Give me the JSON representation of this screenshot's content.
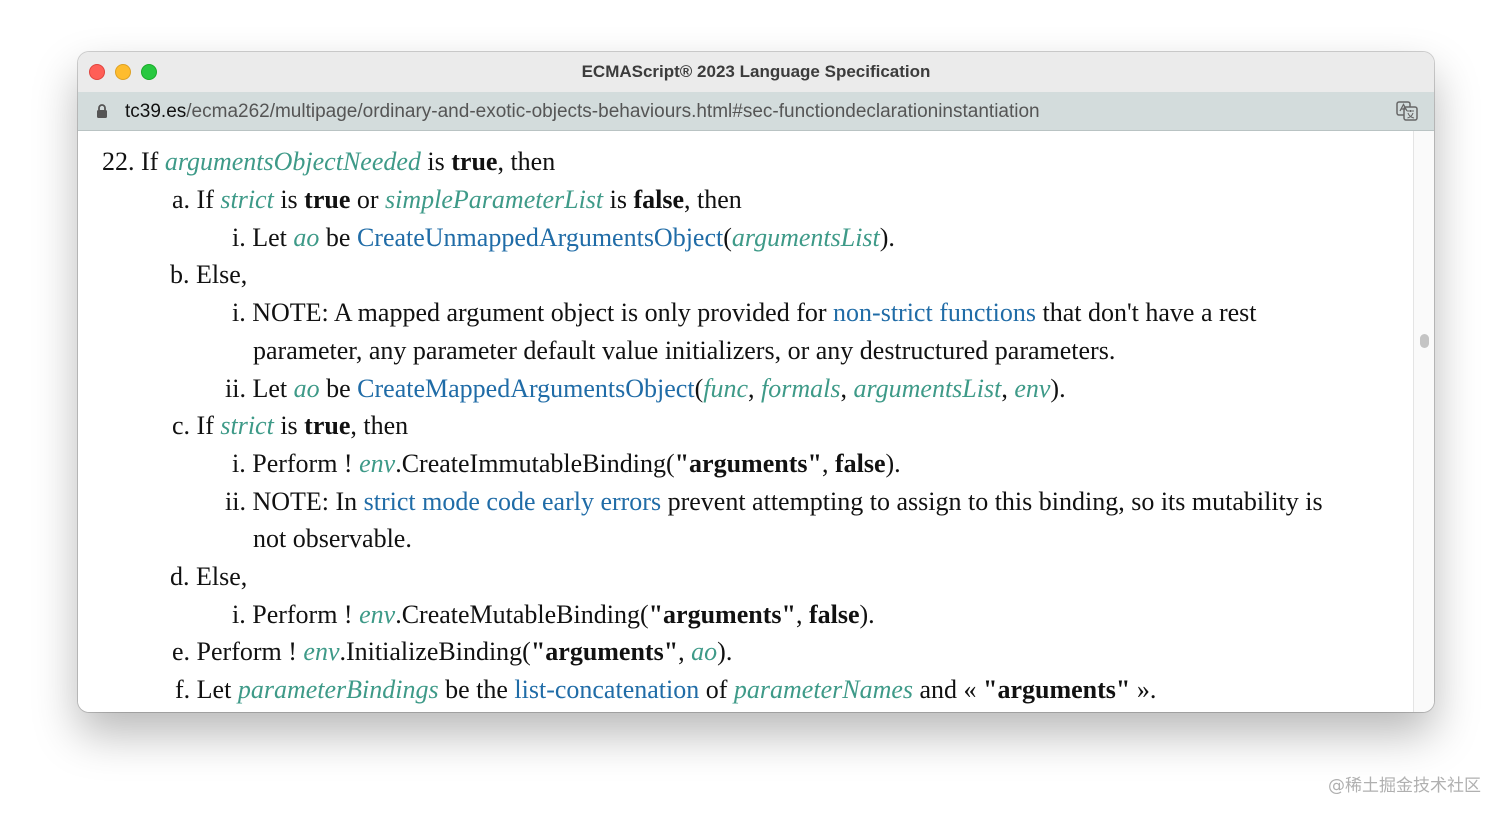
{
  "window": {
    "title": "ECMAScript® 2023 Language Specification",
    "url_host": "tc39.es",
    "url_path": "/ecma262/multipage/ordinary-and-exotic-objects-behaviours.html#sec-functiondeclarationinstantiation"
  },
  "icons": {
    "lock": "lock-icon",
    "translate": "translate-icon"
  },
  "colors": {
    "variable": "#3e9a88",
    "link": "#206ca7",
    "close": "#ff5f57",
    "minimize": "#febc2e",
    "zoom": "#28c840"
  },
  "spec": {
    "s22": {
      "num": "22.",
      "t1": "If ",
      "v1": "argumentsObjectNeeded",
      "t2": " is ",
      "b1": "true",
      "t3": ", then"
    },
    "s22a": {
      "num": "a.",
      "t1": " If ",
      "v1": "strict",
      "t2": " is ",
      "b1": "true",
      "t3": " or ",
      "v2": "simpleParameterList",
      "t4": " is ",
      "b2": "false",
      "t5": ", then"
    },
    "s22ai": {
      "num": "i.",
      "t1": " Let ",
      "v1": "ao",
      "t2": " be ",
      "l1": "CreateUnmappedArgumentsObject",
      "t3": "(",
      "v2": "argumentsList",
      "t4": ")."
    },
    "s22b": {
      "num": "b.",
      "t1": " Else,"
    },
    "s22bi": {
      "num": "i.",
      "t1": " NOTE: A mapped argument object is only provided for ",
      "l1": "non-strict functions",
      "t2": " that don't have a rest",
      "t3": "parameter, any parameter default value initializers, or any destructured parameters."
    },
    "s22bii": {
      "num": "ii.",
      "t1": " Let ",
      "v1": "ao",
      "t2": " be ",
      "l1": "CreateMappedArgumentsObject",
      "t3": "(",
      "v2": "func",
      "t4": ", ",
      "v3": "formals",
      "t5": ", ",
      "v4": "argumentsList",
      "t6": ", ",
      "v5": "env",
      "t7": ")."
    },
    "s22c": {
      "num": "c.",
      "t1": " If ",
      "v1": "strict",
      "t2": " is ",
      "b1": "true",
      "t3": ", then"
    },
    "s22ci": {
      "num": "i.",
      "t1": " Perform ! ",
      "v1": "env",
      "t2": ".CreateImmutableBinding(",
      "b1": "\"arguments\"",
      "t3": ", ",
      "b2": "false",
      "t4": ")."
    },
    "s22cii": {
      "num": "ii.",
      "t1": " NOTE: In ",
      "l1": "strict mode code early errors",
      "t2": " prevent attempting to assign to this binding, so its mutability is",
      "t3": "not observable."
    },
    "s22d": {
      "num": "d.",
      "t1": " Else,"
    },
    "s22di": {
      "num": "i.",
      "t1": " Perform ! ",
      "v1": "env",
      "t2": ".CreateMutableBinding(",
      "b1": "\"arguments\"",
      "t3": ", ",
      "b2": "false",
      "t4": ")."
    },
    "s22e": {
      "num": "e.",
      "t1": " Perform ! ",
      "v1": "env",
      "t2": ".InitializeBinding(",
      "b1": "\"arguments\"",
      "t3": ", ",
      "v2": "ao",
      "t4": ")."
    },
    "s22f": {
      "num": "f.",
      "t1": " Let ",
      "v1": "parameterBindings",
      "t2": " be the ",
      "l1": "list-concatenation",
      "t3": " of ",
      "v2": "parameterNames",
      "t4": " and « ",
      "b1": "\"arguments\"",
      "t5": " »."
    }
  },
  "watermark": "@稀土掘金技术社区"
}
